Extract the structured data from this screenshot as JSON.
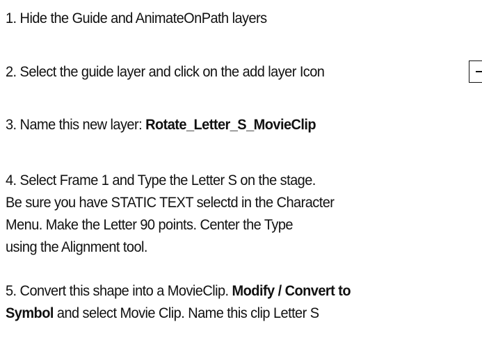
{
  "steps": [
    {
      "text": "1. Hide the Guide and AnimateOnPath layers"
    },
    {
      "text": "2. Select the guide layer and click on the add layer Icon"
    },
    {
      "prefix": "3. Name this new layer: ",
      "bold": "Rotate_Letter_S_MovieClip"
    },
    {
      "lines": [
        "4. Select Frame 1 and Type the Letter S on the stage.",
        "Be sure you have STATIC TEXT selectd in the Character",
        "Menu. Make the Letter 90 points. Center the Type",
        "using the Alignment tool."
      ]
    },
    {
      "part1": "5. Convert this shape into a MovieClip. ",
      "bold1": "Modify / Convert to",
      "bold2": "Symbol",
      "part2": " and select Movie Clip. Name this clip Letter S"
    }
  ],
  "icons": {
    "add_layer": "add-layer-icon"
  }
}
